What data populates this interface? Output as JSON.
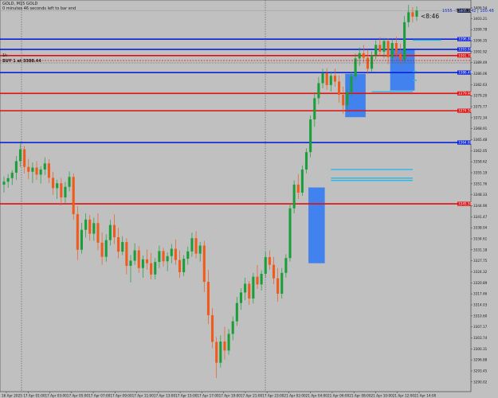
{
  "header": {
    "symbol_line": "GOLD, M15 GOLD",
    "countdown_line": "0 minutes 46 seconds left to bar end",
    "order_marker": "1k",
    "order_line": "BUY 1 at 3388.44"
  },
  "info": {
    "spread_text": "1555 -7 pips | 42 | 100.48",
    "timer_text": "<8:46"
  },
  "colors": {
    "background": "#c0c0c0",
    "bull": "#1a9e3a",
    "bear": "#f05a1a",
    "resistance": "#e01010",
    "support": "#0a22d8",
    "zone": "#3a7ef0",
    "ray": "#28b8e8",
    "vline": "#555555"
  },
  "chart_data": {
    "type": "candlestick",
    "title": "GOLD, M15",
    "x_tick_labels": [
      "16 Apr 2025",
      "17 Apr 01:00",
      "17 Apr 03:00",
      "17 Apr 05:00",
      "17 Apr 07:00",
      "17 Apr 09:00",
      "17 Apr 11:00",
      "17 Apr 13:00",
      "17 Apr 15:00",
      "17 Apr 17:00",
      "17 Apr 19:00",
      "17 Apr 21:00",
      "17 Apr 23:00",
      "21 Apr 02:00",
      "21 Apr 04:00",
      "21 Apr 06:00",
      "21 Apr 08:00",
      "21 Apr 10:00",
      "21 Apr 12:00",
      "21 Apr 14:00"
    ],
    "y_tick_labels": [
      "3406.54",
      "3403.21",
      "3399.78",
      "3396.35",
      "3392.92",
      "3389.49",
      "3386.06",
      "3382.63",
      "3379.20",
      "3375.77",
      "3372.34",
      "3368.91",
      "3365.48",
      "3362.05",
      "3358.62",
      "3355.19",
      "3351.76",
      "3348.33",
      "3344.90",
      "3341.47",
      "3338.04",
      "3334.61",
      "3331.18",
      "3327.75",
      "3324.32",
      "3320.89",
      "3317.46",
      "3314.03",
      "3310.60",
      "3307.17",
      "3303.74",
      "3300.31",
      "3296.88",
      "3293.45",
      "3290.02"
    ],
    "ylim": [
      3287.0,
      3409.0
    ],
    "horizontal_levels": [
      {
        "kind": "support",
        "price": 3396.8,
        "label": "3396.80"
      },
      {
        "kind": "support",
        "price": 3393.6,
        "label": "3393.60"
      },
      {
        "kind": "resistance",
        "price": 3391.7,
        "label": "3391.70"
      },
      {
        "kind": "support",
        "price": 3386.4,
        "label": "3386.40"
      },
      {
        "kind": "resistance",
        "price": 3379.9,
        "label": "3379.90"
      },
      {
        "kind": "resistance",
        "price": 3374.5,
        "label": "3374.50"
      },
      {
        "kind": "support",
        "price": 3364.6,
        "label": "3364.60"
      },
      {
        "kind": "resistance",
        "price": 3345.5,
        "label": "3345.50"
      }
    ],
    "current_price": {
      "price": 3405.7,
      "label": "3405.70"
    },
    "candles": [
      {
        "o": 3351.5,
        "h": 3354.0,
        "l": 3349.0,
        "c": 3352.4
      },
      {
        "o": 3352.4,
        "h": 3354.8,
        "l": 3350.5,
        "c": 3353.5
      },
      {
        "o": 3353.5,
        "h": 3356.0,
        "l": 3351.4,
        "c": 3355.2
      },
      {
        "o": 3355.2,
        "h": 3360.4,
        "l": 3353.0,
        "c": 3358.8
      },
      {
        "o": 3358.8,
        "h": 3364.2,
        "l": 3357.0,
        "c": 3362.5
      },
      {
        "o": 3362.5,
        "h": 3363.5,
        "l": 3355.0,
        "c": 3357.0
      },
      {
        "o": 3357.0,
        "h": 3359.5,
        "l": 3353.2,
        "c": 3355.5
      },
      {
        "o": 3355.5,
        "h": 3358.4,
        "l": 3352.0,
        "c": 3356.8
      },
      {
        "o": 3356.8,
        "h": 3358.8,
        "l": 3353.0,
        "c": 3354.6
      },
      {
        "o": 3354.6,
        "h": 3357.2,
        "l": 3351.8,
        "c": 3356.2
      },
      {
        "o": 3356.2,
        "h": 3360.0,
        "l": 3354.5,
        "c": 3358.1
      },
      {
        "o": 3358.1,
        "h": 3359.4,
        "l": 3352.0,
        "c": 3353.6
      },
      {
        "o": 3353.6,
        "h": 3355.5,
        "l": 3348.3,
        "c": 3350.4
      },
      {
        "o": 3350.4,
        "h": 3353.0,
        "l": 3347.0,
        "c": 3351.9
      },
      {
        "o": 3351.9,
        "h": 3353.6,
        "l": 3345.0,
        "c": 3347.5
      },
      {
        "o": 3347.5,
        "h": 3352.3,
        "l": 3345.8,
        "c": 3350.8
      },
      {
        "o": 3350.8,
        "h": 3355.6,
        "l": 3349.4,
        "c": 3353.9
      },
      {
        "o": 3353.9,
        "h": 3355.0,
        "l": 3340.5,
        "c": 3342.3
      },
      {
        "o": 3342.3,
        "h": 3344.8,
        "l": 3328.0,
        "c": 3331.2
      },
      {
        "o": 3331.2,
        "h": 3339.6,
        "l": 3330.0,
        "c": 3337.4
      },
      {
        "o": 3337.4,
        "h": 3342.5,
        "l": 3335.0,
        "c": 3340.6
      },
      {
        "o": 3340.6,
        "h": 3342.0,
        "l": 3334.0,
        "c": 3336.2
      },
      {
        "o": 3336.2,
        "h": 3341.2,
        "l": 3334.0,
        "c": 3339.5
      },
      {
        "o": 3339.5,
        "h": 3342.5,
        "l": 3331.0,
        "c": 3333.4
      },
      {
        "o": 3333.4,
        "h": 3336.6,
        "l": 3326.5,
        "c": 3329.0
      },
      {
        "o": 3329.0,
        "h": 3336.0,
        "l": 3327.5,
        "c": 3334.2
      },
      {
        "o": 3334.2,
        "h": 3340.5,
        "l": 3332.5,
        "c": 3338.9
      },
      {
        "o": 3338.9,
        "h": 3342.2,
        "l": 3333.0,
        "c": 3335.1
      },
      {
        "o": 3335.1,
        "h": 3338.0,
        "l": 3328.5,
        "c": 3330.6
      },
      {
        "o": 3330.6,
        "h": 3335.4,
        "l": 3329.5,
        "c": 3333.6
      },
      {
        "o": 3333.6,
        "h": 3334.8,
        "l": 3323.5,
        "c": 3326.2
      },
      {
        "o": 3326.2,
        "h": 3329.5,
        "l": 3321.0,
        "c": 3327.8
      },
      {
        "o": 3327.8,
        "h": 3333.2,
        "l": 3326.5,
        "c": 3331.0
      },
      {
        "o": 3331.0,
        "h": 3332.4,
        "l": 3324.0,
        "c": 3325.5
      },
      {
        "o": 3325.5,
        "h": 3329.4,
        "l": 3322.5,
        "c": 3328.2
      },
      {
        "o": 3328.2,
        "h": 3331.3,
        "l": 3325.0,
        "c": 3327.0
      },
      {
        "o": 3327.0,
        "h": 3330.2,
        "l": 3322.0,
        "c": 3323.5
      },
      {
        "o": 3323.5,
        "h": 3328.6,
        "l": 3322.0,
        "c": 3327.4
      },
      {
        "o": 3327.4,
        "h": 3332.5,
        "l": 3325.5,
        "c": 3330.8
      },
      {
        "o": 3330.8,
        "h": 3331.8,
        "l": 3326.0,
        "c": 3327.6
      },
      {
        "o": 3327.6,
        "h": 3330.4,
        "l": 3324.5,
        "c": 3329.2
      },
      {
        "o": 3329.2,
        "h": 3333.0,
        "l": 3327.0,
        "c": 3331.5
      },
      {
        "o": 3331.5,
        "h": 3334.4,
        "l": 3326.5,
        "c": 3328.0
      },
      {
        "o": 3328.0,
        "h": 3331.0,
        "l": 3322.5,
        "c": 3324.2
      },
      {
        "o": 3324.2,
        "h": 3329.5,
        "l": 3323.0,
        "c": 3328.4
      },
      {
        "o": 3328.4,
        "h": 3332.2,
        "l": 3326.5,
        "c": 3330.7
      },
      {
        "o": 3330.7,
        "h": 3336.5,
        "l": 3329.0,
        "c": 3334.8
      },
      {
        "o": 3334.8,
        "h": 3337.0,
        "l": 3328.5,
        "c": 3330.0
      },
      {
        "o": 3330.0,
        "h": 3333.6,
        "l": 3327.5,
        "c": 3332.5
      },
      {
        "o": 3332.5,
        "h": 3334.0,
        "l": 3318.0,
        "c": 3321.2
      },
      {
        "o": 3321.2,
        "h": 3325.0,
        "l": 3308.0,
        "c": 3310.8
      },
      {
        "o": 3310.8,
        "h": 3313.0,
        "l": 3300.5,
        "c": 3302.5
      },
      {
        "o": 3302.5,
        "h": 3304.0,
        "l": 3291.2,
        "c": 3296.0
      },
      {
        "o": 3296.0,
        "h": 3304.5,
        "l": 3294.5,
        "c": 3302.6
      },
      {
        "o": 3302.6,
        "h": 3307.2,
        "l": 3297.0,
        "c": 3299.8
      },
      {
        "o": 3299.8,
        "h": 3306.5,
        "l": 3298.5,
        "c": 3305.0
      },
      {
        "o": 3305.0,
        "h": 3310.4,
        "l": 3303.0,
        "c": 3308.9
      },
      {
        "o": 3308.9,
        "h": 3316.5,
        "l": 3307.5,
        "c": 3314.6
      },
      {
        "o": 3314.6,
        "h": 3319.2,
        "l": 3312.5,
        "c": 3317.9
      },
      {
        "o": 3317.9,
        "h": 3322.5,
        "l": 3315.5,
        "c": 3320.6
      },
      {
        "o": 3320.6,
        "h": 3321.5,
        "l": 3314.0,
        "c": 3316.0
      },
      {
        "o": 3316.0,
        "h": 3324.0,
        "l": 3314.5,
        "c": 3322.8
      },
      {
        "o": 3322.8,
        "h": 3326.5,
        "l": 3319.0,
        "c": 3320.4
      },
      {
        "o": 3320.4,
        "h": 3324.8,
        "l": 3318.5,
        "c": 3323.7
      },
      {
        "o": 3323.7,
        "h": 3330.5,
        "l": 3322.5,
        "c": 3328.9
      },
      {
        "o": 3328.9,
        "h": 3331.0,
        "l": 3325.0,
        "c": 3326.5
      },
      {
        "o": 3326.5,
        "h": 3329.0,
        "l": 3320.5,
        "c": 3322.3
      },
      {
        "o": 3322.3,
        "h": 3325.5,
        "l": 3315.0,
        "c": 3317.5
      },
      {
        "o": 3317.5,
        "h": 3325.5,
        "l": 3316.0,
        "c": 3324.0
      },
      {
        "o": 3324.0,
        "h": 3329.8,
        "l": 3322.5,
        "c": 3328.6
      },
      {
        "o": 3328.6,
        "h": 3345.5,
        "l": 3327.5,
        "c": 3344.1
      },
      {
        "o": 3344.1,
        "h": 3352.8,
        "l": 3342.5,
        "c": 3351.5
      },
      {
        "o": 3351.5,
        "h": 3354.8,
        "l": 3347.0,
        "c": 3349.0
      },
      {
        "o": 3349.0,
        "h": 3357.5,
        "l": 3348.0,
        "c": 3356.2
      },
      {
        "o": 3356.2,
        "h": 3362.8,
        "l": 3355.0,
        "c": 3361.6
      },
      {
        "o": 3361.6,
        "h": 3373.0,
        "l": 3360.0,
        "c": 3371.8
      },
      {
        "o": 3371.8,
        "h": 3380.2,
        "l": 3369.5,
        "c": 3378.4
      },
      {
        "o": 3378.4,
        "h": 3385.0,
        "l": 3376.5,
        "c": 3383.1
      },
      {
        "o": 3383.1,
        "h": 3387.6,
        "l": 3381.5,
        "c": 3386.2
      },
      {
        "o": 3386.2,
        "h": 3387.8,
        "l": 3381.0,
        "c": 3382.5
      },
      {
        "o": 3382.5,
        "h": 3386.5,
        "l": 3380.5,
        "c": 3385.4
      },
      {
        "o": 3385.4,
        "h": 3387.6,
        "l": 3382.0,
        "c": 3383.6
      },
      {
        "o": 3383.6,
        "h": 3385.5,
        "l": 3377.0,
        "c": 3379.5
      },
      {
        "o": 3379.5,
        "h": 3382.0,
        "l": 3373.5,
        "c": 3376.2
      },
      {
        "o": 3376.2,
        "h": 3381.5,
        "l": 3374.5,
        "c": 3380.3
      },
      {
        "o": 3380.3,
        "h": 3386.6,
        "l": 3379.0,
        "c": 3385.2
      },
      {
        "o": 3385.2,
        "h": 3392.3,
        "l": 3384.0,
        "c": 3390.8
      },
      {
        "o": 3390.8,
        "h": 3394.2,
        "l": 3388.5,
        "c": 3392.4
      },
      {
        "o": 3392.4,
        "h": 3395.0,
        "l": 3389.5,
        "c": 3391.0
      },
      {
        "o": 3391.0,
        "h": 3393.5,
        "l": 3386.0,
        "c": 3387.6
      },
      {
        "o": 3387.6,
        "h": 3393.0,
        "l": 3386.5,
        "c": 3391.8
      },
      {
        "o": 3391.8,
        "h": 3396.4,
        "l": 3390.5,
        "c": 3395.0
      },
      {
        "o": 3395.0,
        "h": 3397.5,
        "l": 3391.5,
        "c": 3392.9
      },
      {
        "o": 3392.9,
        "h": 3397.2,
        "l": 3391.0,
        "c": 3396.2
      },
      {
        "o": 3396.2,
        "h": 3397.0,
        "l": 3389.0,
        "c": 3391.2
      },
      {
        "o": 3391.2,
        "h": 3396.8,
        "l": 3389.5,
        "c": 3395.6
      },
      {
        "o": 3395.6,
        "h": 3397.6,
        "l": 3390.5,
        "c": 3392.3
      },
      {
        "o": 3392.3,
        "h": 3395.4,
        "l": 3388.5,
        "c": 3390.4
      },
      {
        "o": 3390.4,
        "h": 3404.0,
        "l": 3389.5,
        "c": 3402.1
      },
      {
        "o": 3402.1,
        "h": 3407.5,
        "l": 3400.5,
        "c": 3405.2
      },
      {
        "o": 3405.2,
        "h": 3406.8,
        "l": 3402.0,
        "c": 3403.8
      },
      {
        "o": 3403.8,
        "h": 3407.0,
        "l": 3402.5,
        "c": 3405.7
      }
    ],
    "demand_zones": [
      {
        "from_candle": 75,
        "to_candle": 78,
        "price_low": 3327.0,
        "price_high": 3350.6
      },
      {
        "from_candle": 84,
        "to_candle": 88,
        "price_low": 3372.5,
        "price_high": 3386.0
      },
      {
        "from_candle": 95,
        "to_candle": 100,
        "price_low": 3380.8,
        "price_high": 3393.7
      }
    ],
    "ray_levels": [
      {
        "from_candle": 80,
        "price": 3356.2
      },
      {
        "from_candle": 80,
        "price": 3353.5
      },
      {
        "from_candle": 80,
        "price": 3352.8
      },
      {
        "from_candle": 90,
        "price": 3380.4
      },
      {
        "from_candle": 101,
        "price": 3384.0
      },
      {
        "from_candle": 101,
        "price": 3386.7
      },
      {
        "from_candle": 107,
        "price": 3396.5
      }
    ]
  }
}
